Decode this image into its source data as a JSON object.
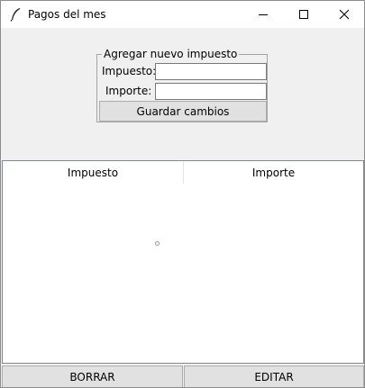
{
  "window": {
    "title": "Pagos del mes",
    "icon": "feather-icon",
    "controls": {
      "minimize": "minimize-icon",
      "maximize": "maximize-icon",
      "close": "close-icon"
    }
  },
  "form": {
    "group_label": "Agregar nuevo impuesto",
    "impuesto_label": "Impuesto:",
    "impuesto_value": "",
    "importe_label": "Importe:",
    "importe_value": "",
    "save_label": "Guardar cambios"
  },
  "table": {
    "columns": [
      "Impuesto",
      "Importe"
    ],
    "rows": []
  },
  "actions": {
    "delete_label": "BORRAR",
    "edit_label": "EDITAR"
  }
}
